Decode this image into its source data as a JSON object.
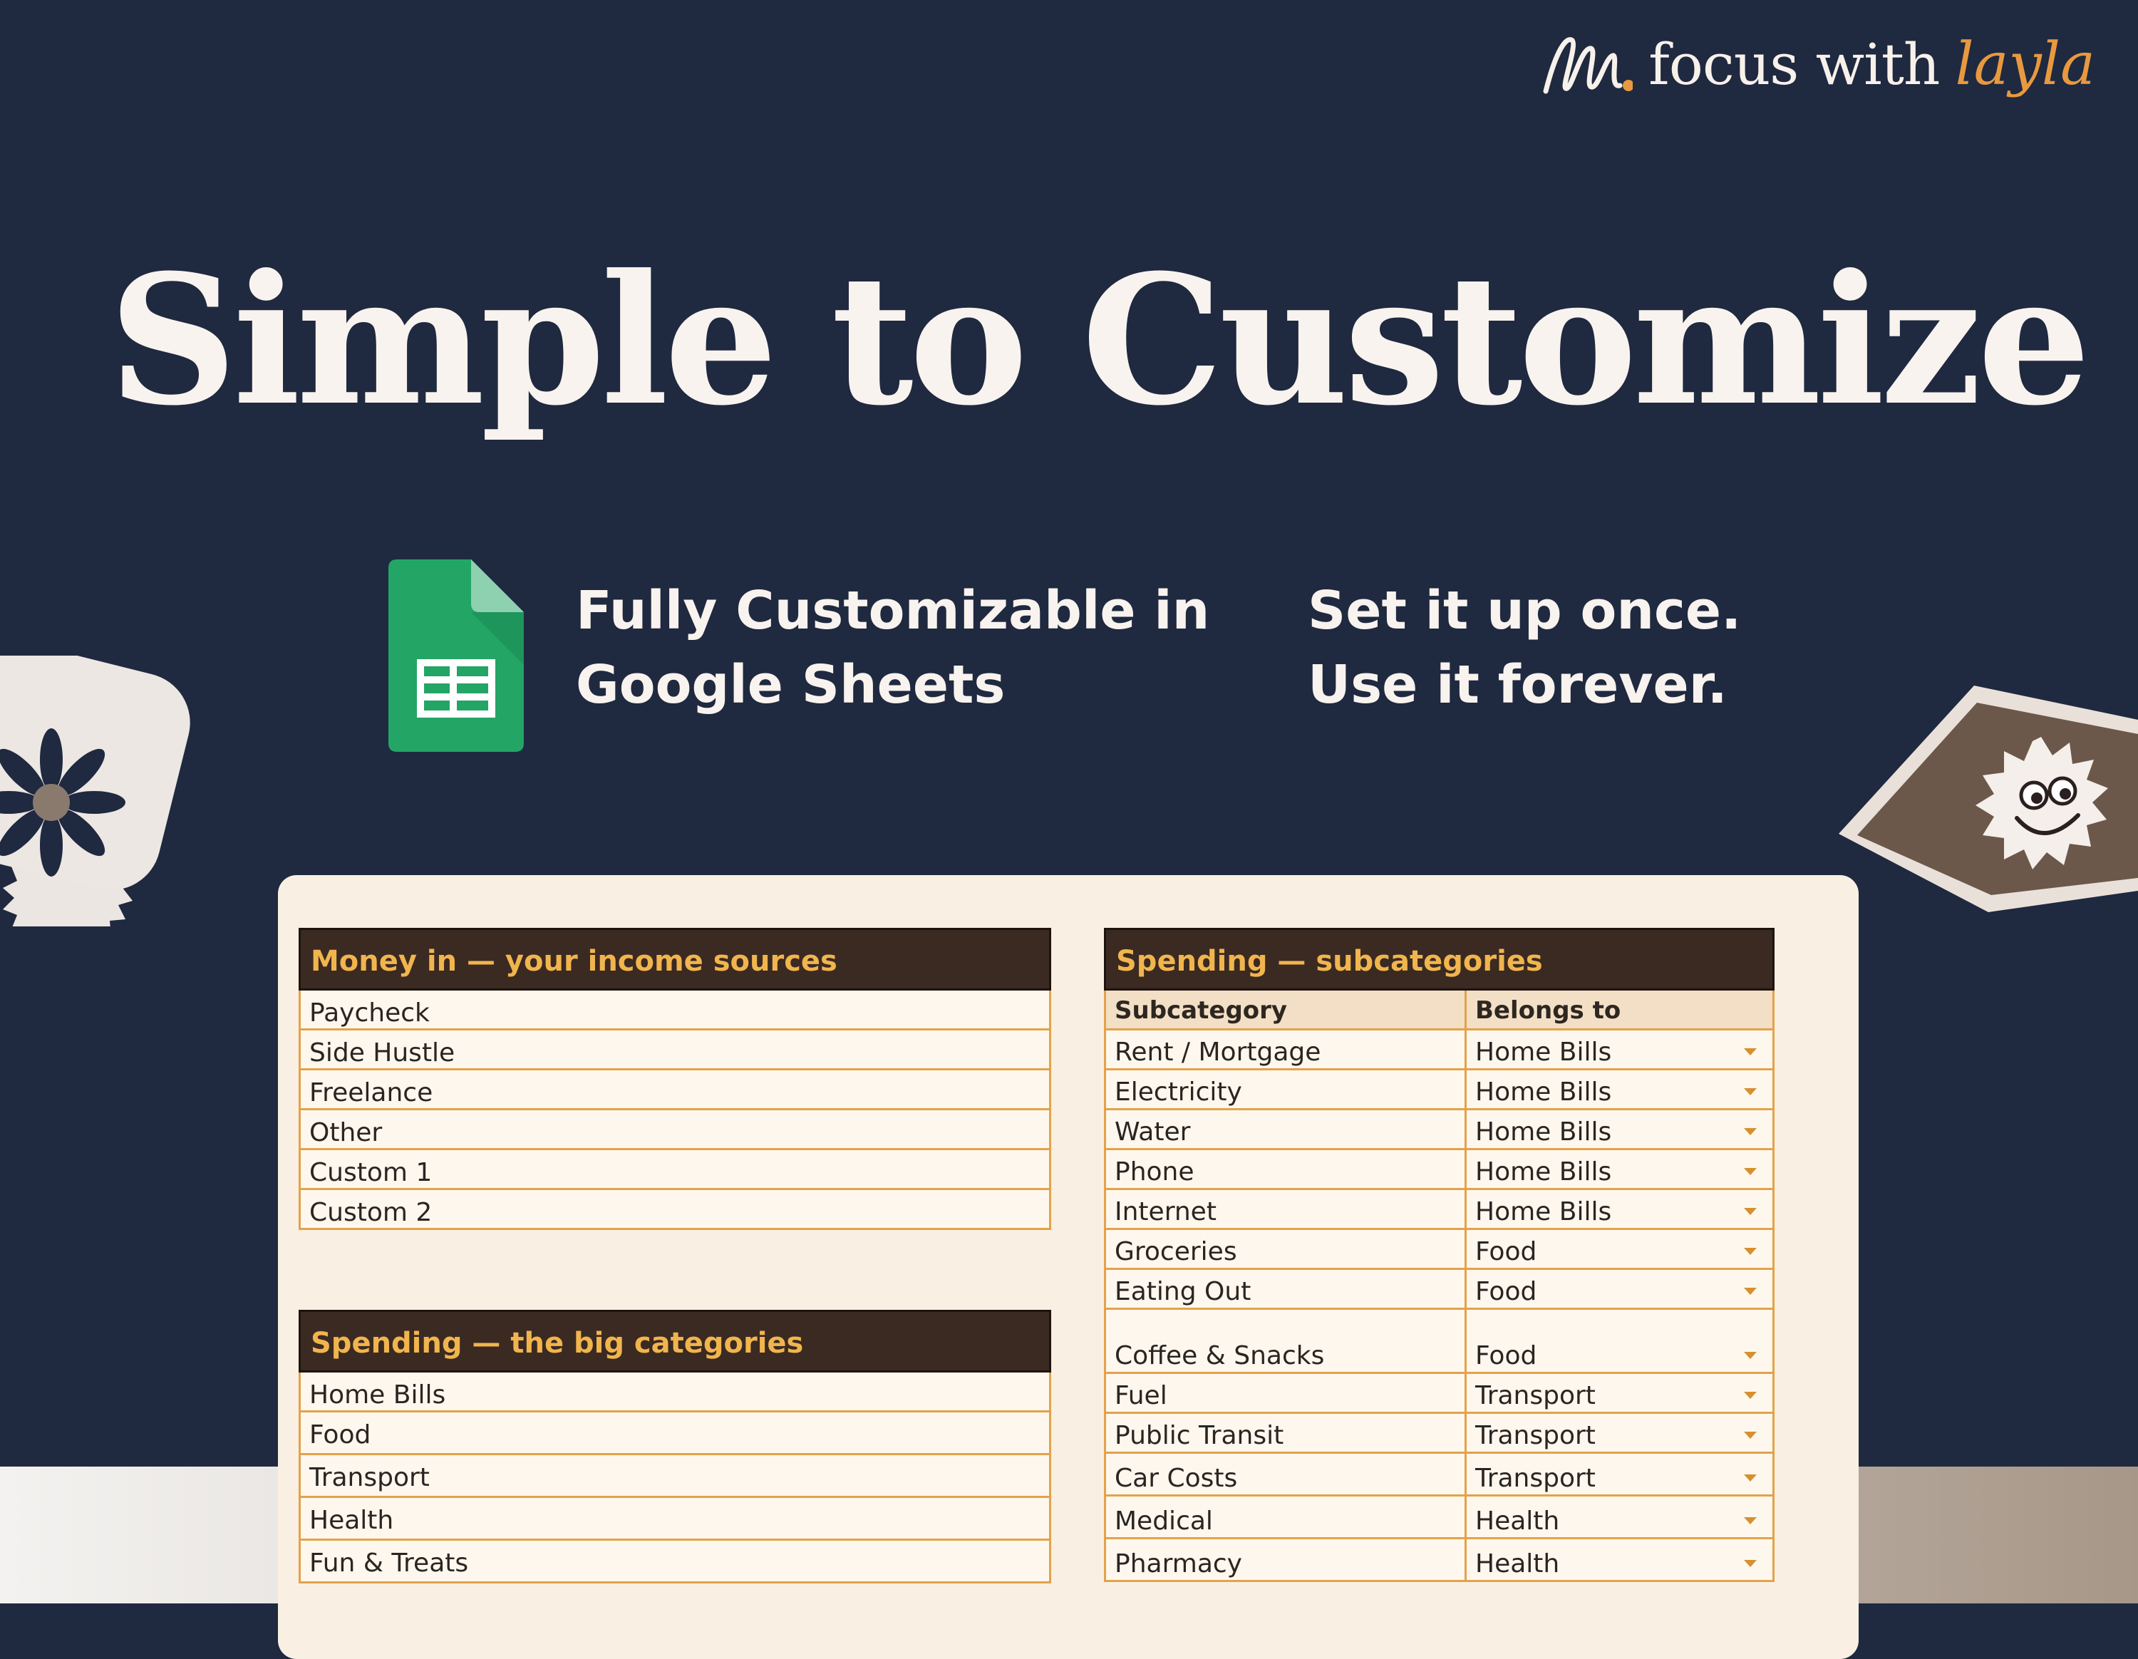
{
  "brand": {
    "name": "focus with",
    "accent": "layla",
    "accent_color": "#e8993f"
  },
  "headline": "Simple to Customize",
  "features": [
    {
      "line1": "Fully Customizable in",
      "line2": "Google Sheets"
    },
    {
      "line1": "Set it up once.",
      "line2": "Use it forever."
    }
  ],
  "income": {
    "title": "Money in — your income sources",
    "items": [
      "Paycheck",
      "Side Hustle",
      "Freelance",
      "Other",
      "Custom 1",
      "Custom 2"
    ]
  },
  "big_categories": {
    "title": "Spending — the big categories",
    "items": [
      "Home Bills",
      "Food",
      "Transport",
      "Health",
      "Fun & Treats"
    ]
  },
  "subcategories": {
    "title": "Spending — subcategories",
    "col1": "Subcategory",
    "col2": "Belongs to",
    "rows": [
      {
        "name": "Rent / Mortgage",
        "group": "Home Bills"
      },
      {
        "name": "Electricity",
        "group": "Home Bills"
      },
      {
        "name": "Water",
        "group": "Home Bills"
      },
      {
        "name": "Phone",
        "group": "Home Bills"
      },
      {
        "name": "Internet",
        "group": "Home Bills"
      },
      {
        "name": "Groceries",
        "group": "Food"
      },
      {
        "name": "Eating Out",
        "group": "Food"
      },
      {
        "name": "Coffee & Snacks",
        "group": "Food"
      },
      {
        "name": "Fuel",
        "group": "Transport"
      },
      {
        "name": "Public Transit",
        "group": "Transport"
      },
      {
        "name": "Car Costs",
        "group": "Transport"
      },
      {
        "name": "Medical",
        "group": "Health"
      },
      {
        "name": "Pharmacy",
        "group": "Health"
      }
    ]
  },
  "colors": {
    "background": "#1f2940",
    "table_header": "#3b2a22",
    "header_text": "#f1b54d",
    "grid_line": "#e3a24a",
    "sheets_green": "#23a566"
  }
}
